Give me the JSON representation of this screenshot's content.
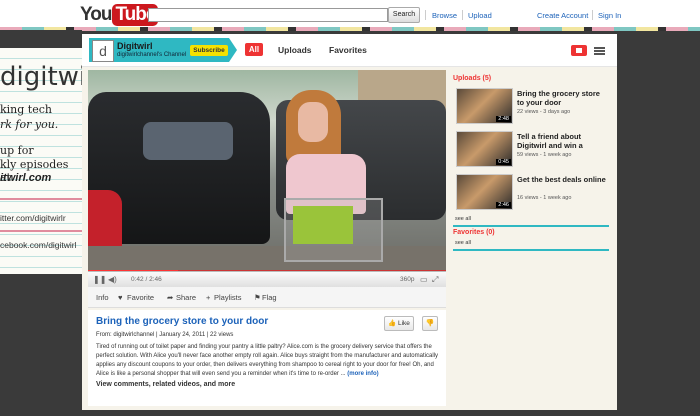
{
  "header": {
    "logo_you": "You",
    "logo_tube": "Tube",
    "search_button": "Search",
    "links": [
      "Browse",
      "Upload",
      "Create Account",
      "Sign In"
    ]
  },
  "background": {
    "brand": "digitwirl",
    "lines": [
      "king tech",
      "rk for you.",
      "up for",
      "kly episodes at",
      "itwirl.com"
    ],
    "social": [
      "itter.com/digitwirlr",
      "cebook.com/digitwirl"
    ]
  },
  "channel": {
    "name": "Digitwirl",
    "subtitle": "digitwirlchannel's Channel",
    "subscribe": "Subscribe",
    "avatar_letter": "d",
    "tabs": [
      "All",
      "Uploads",
      "Favorites"
    ]
  },
  "player": {
    "time": "0:42 / 2:46",
    "quality": "360p",
    "progress": 0.25,
    "actions": [
      "Info",
      "Favorite",
      "Share",
      "Playlists",
      "Flag"
    ]
  },
  "video": {
    "title": "Bring the grocery store to your door",
    "meta": "From: digitwirlchannel | January 24, 2011 | 22 views",
    "like": "Like",
    "description": "Tired of running out of toilet paper and finding your pantry a little paltry? Alice.com is the grocery delivery service that offers the perfect solution. With Alice you'll never face another empty roll again. Alice buys straight from the manufacturer and automatically applies any discount coupons to your order, then delivers everything from shampoo to cereal right to your door for free! Oh, and Alice is like a personal shopper that will even send you a reminder when it's time to re-order ...",
    "more": "(more info)",
    "view_comments": "View comments, related videos, and more"
  },
  "sidebar": {
    "uploads_heading": "Uploads (5)",
    "uploads": [
      {
        "title": "Bring the grocery store to your door",
        "meta": "22 views - 3 days ago",
        "duration": "2:48"
      },
      {
        "title": "Tell a friend about Digitwirl and win a",
        "meta": "59 views - 1 week ago",
        "duration": "0:45"
      },
      {
        "title": "Get the best deals online",
        "meta": "16 views - 1 week ago",
        "duration": "2:46"
      }
    ],
    "see_all": "see all",
    "favorites_heading": "Favorites (0)",
    "favorites_see_all": "see all"
  },
  "colors": {
    "accent_red": "#e33333",
    "channel_teal": "#2fb8c2",
    "link_blue": "#1c62b9",
    "subscribe_yellow": "#f5e100"
  }
}
